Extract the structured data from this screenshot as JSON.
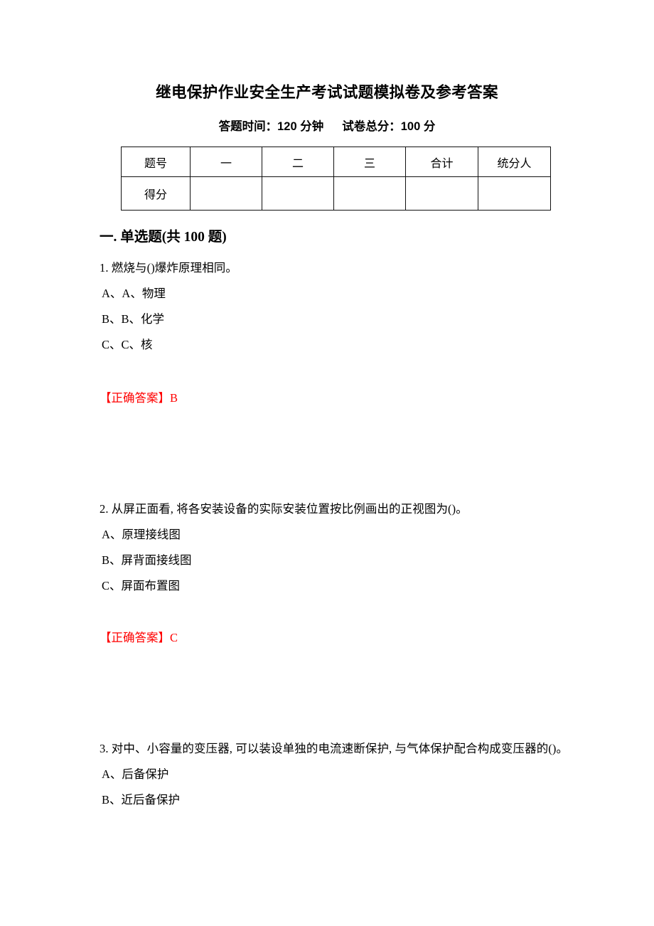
{
  "document": {
    "title": "继电保护作业安全生产考试试题模拟卷及参考答案",
    "subtitle_time": "答题时间：120 分钟",
    "subtitle_total": "试卷总分：100 分",
    "answer_color": "#ff0000"
  },
  "score_table": {
    "header": [
      "题号",
      "一",
      "二",
      "三",
      "合计",
      "统分人"
    ],
    "rows": [
      {
        "label": "得分",
        "cells": [
          "",
          "",
          "",
          "",
          ""
        ]
      }
    ]
  },
  "section": {
    "heading": "一. 单选题(共 100 题)"
  },
  "questions": [
    {
      "stem": "1. 燃烧与()爆炸原理相同。",
      "options": [
        "A、A、物理",
        "B、B、化学",
        "C、C、核"
      ],
      "answer_label": "【正确答案】",
      "answer_value": "B"
    },
    {
      "stem": "2. 从屏正面看, 将各安装设备的实际安装位置按比例画出的正视图为()。",
      "options": [
        "A、原理接线图",
        "B、屏背面接线图",
        "C、屏面布置图"
      ],
      "answer_label": "【正确答案】",
      "answer_value": "C"
    },
    {
      "stem": "3. 对中、小容量的变压器, 可以装设单独的电流速断保护, 与气体保护配合构成变压器的()。",
      "options": [
        "A、后备保护",
        "B、近后备保护"
      ],
      "answer_label": "",
      "answer_value": ""
    }
  ]
}
